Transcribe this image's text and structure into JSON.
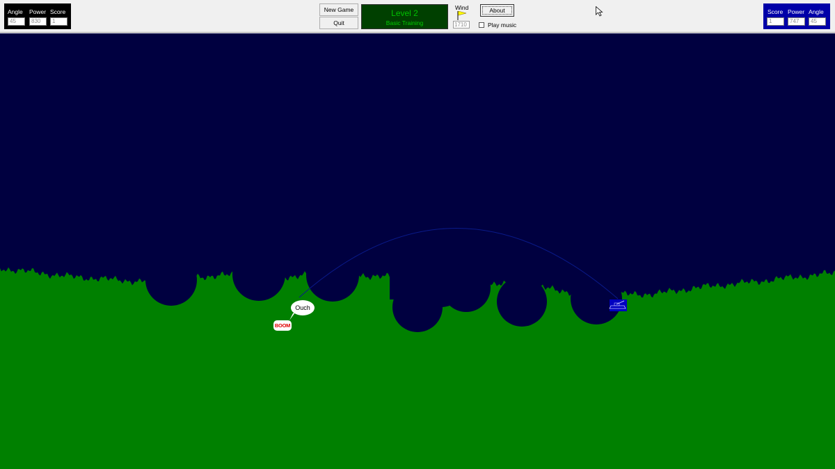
{
  "player1": {
    "angle_label": "Angle",
    "power_label": "Power",
    "score_label": "Score",
    "angle": "45",
    "power": "830",
    "score": "1",
    "color": "#000000"
  },
  "player2": {
    "score_label": "Score",
    "power_label": "Power",
    "angle_label": "Angle",
    "score": "1",
    "power": "747",
    "angle": "45",
    "color": "#0000a8"
  },
  "buttons": {
    "new_game": "New Game",
    "quit": "Quit",
    "about": "About"
  },
  "level": {
    "title": "Level 2",
    "subtitle": "Basic Training"
  },
  "wind": {
    "label": "Wind",
    "value": "1710",
    "icon": "flag-icon"
  },
  "music": {
    "label": "Play music",
    "checked": false
  },
  "game": {
    "sky_color": "#000040",
    "ground_color": "#008000",
    "speech_text": "Ouch",
    "explosion_text": "BOOM",
    "tank_color": "#0000c0",
    "tank_icon": "tank-icon"
  }
}
